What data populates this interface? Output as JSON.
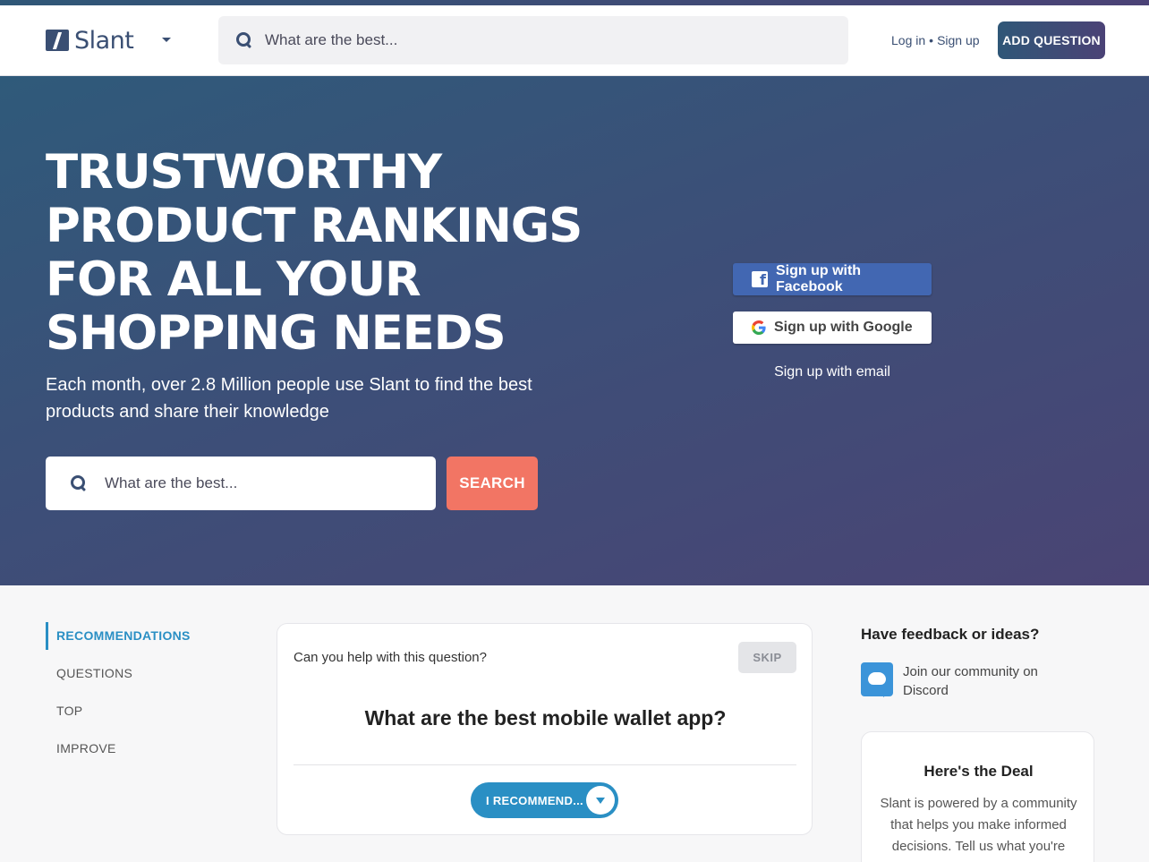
{
  "header": {
    "logo_text": "Slant",
    "search_placeholder": "What are the best...",
    "login_label": "Log in",
    "separator": "•",
    "signup_label": "Sign up",
    "add_question_label": "ADD QUESTION"
  },
  "hero": {
    "title_lines": [
      "TRUSTWORTHY",
      "PRODUCT RANKINGS",
      "FOR ALL YOUR",
      "SHOPPING NEEDS"
    ],
    "subtitle": "Each month, over 2.8 Million people use Slant to find the best products and share their knowledge",
    "search_placeholder": "What are the best...",
    "search_button_label": "SEARCH",
    "facebook_label": "Sign up with Facebook",
    "google_label": "Sign up with Google",
    "email_label": "Sign up with email"
  },
  "sidebar": {
    "items": [
      {
        "label": "RECOMMENDATIONS",
        "active": true
      },
      {
        "label": "QUESTIONS",
        "active": false
      },
      {
        "label": "TOP",
        "active": false
      },
      {
        "label": "IMPROVE",
        "active": false
      }
    ]
  },
  "question_card": {
    "prompt": "Can you help with this question?",
    "skip_label": "SKIP",
    "question": "What are the best mobile wallet app?",
    "recommend_label": "I RECOMMEND..."
  },
  "feedback": {
    "title": "Have feedback or ideas?",
    "discord_text": "Join our community on Discord"
  },
  "deal": {
    "title": "Here's the Deal",
    "body": "Slant is powered by a community that helps you make informed decisions. Tell us what you're"
  },
  "colors": {
    "brand": "#3a4f73",
    "accent_blue": "#2a8fc4",
    "search_button": "#f27564",
    "facebook": "#4267b2"
  },
  "icons": [
    "search-icon",
    "chevron-down-icon",
    "facebook-icon",
    "google-icon",
    "discord-icon"
  ]
}
